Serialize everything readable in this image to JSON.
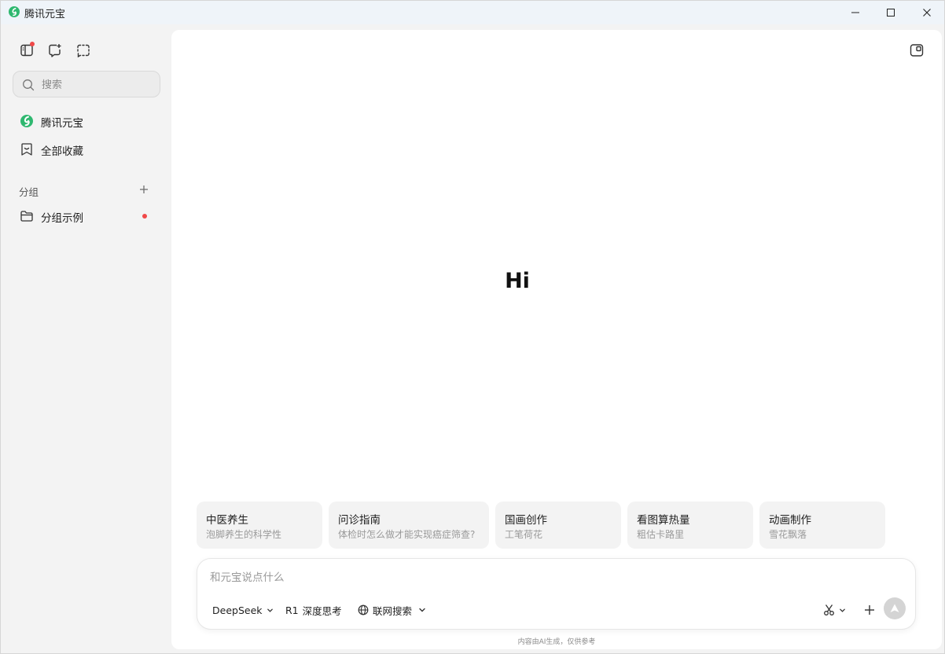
{
  "window": {
    "title": "腾讯元宝"
  },
  "colors": {
    "brand_green": "#2fb870",
    "notification_red": "#f04848",
    "send_disabled": "#d4d4d4"
  },
  "sidebar": {
    "top_icons": [
      "sidebar-toggle-icon",
      "new-chat-icon",
      "screenshot-icon"
    ],
    "search": {
      "placeholder": "搜索"
    },
    "items": [
      {
        "label": "腾讯元宝",
        "icon": "yuanbao-logo-icon"
      },
      {
        "label": "全部收藏",
        "icon": "bookmark-icon"
      }
    ],
    "groups": {
      "header": "分组",
      "items": [
        {
          "label": "分组示例",
          "icon": "folder-icon",
          "has_dot": true
        }
      ]
    }
  },
  "main": {
    "greeting": "Hi",
    "suggestions": [
      {
        "title": "中医养生",
        "subtitle": "泡脚养生的科学性"
      },
      {
        "title": "问诊指南",
        "subtitle": "体检时怎么做才能实现癌症筛查?"
      },
      {
        "title": "国画创作",
        "subtitle": "工笔荷花"
      },
      {
        "title": "看图算热量",
        "subtitle": "粗估卡路里"
      },
      {
        "title": "动画制作",
        "subtitle": "雪花飘落"
      }
    ],
    "composer": {
      "placeholder": "和元宝说点什么",
      "model_label": "DeepSeek",
      "think_label": "深度思考",
      "think_prefix": "R1",
      "web_label": "联网搜索"
    },
    "disclaimer": "内容由AI生成，仅供参考"
  }
}
